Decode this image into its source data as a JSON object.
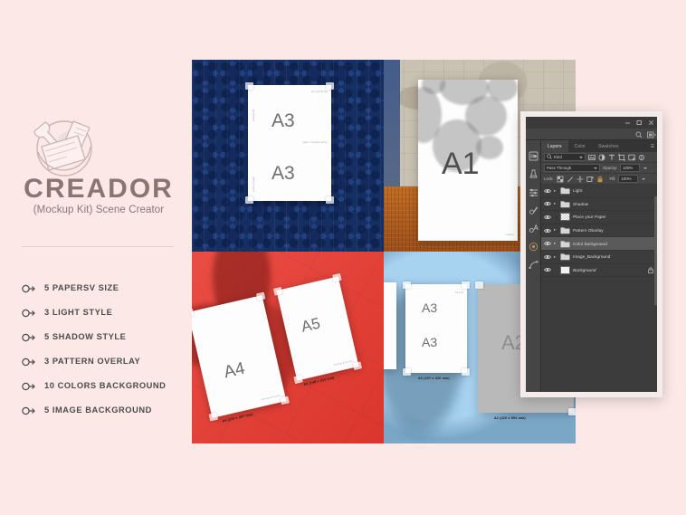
{
  "background_color": "#fce9e7",
  "brand": {
    "logo_icon": "toolbox-mockup-kit-logo",
    "title": "CREADOR",
    "subtitle": "(Mockup Kit) Scene Creator",
    "title_color": "#8a7573"
  },
  "features": {
    "bullet_icon": "arrow-in-circle-icon",
    "items": [
      {
        "label": "5 PAPERSV SIZE"
      },
      {
        "label": "3 LIGHT STYLE"
      },
      {
        "label": "5 SHADOW STYLE"
      },
      {
        "label": "3 PATTERN OVERLAY"
      },
      {
        "label": "10 COLORS BACKGROUND"
      },
      {
        "label": "5 IMAGE BACKGROUND"
      }
    ]
  },
  "collage": {
    "quadrants": [
      {
        "name": "navy-ornate-tile",
        "color": "#23417f"
      },
      {
        "name": "beige-stone-orange",
        "color": "#c9c2b3"
      },
      {
        "name": "red-flat",
        "color": "#e8392f"
      },
      {
        "name": "light-blue",
        "color": "#7ba7c7"
      }
    ],
    "papers": [
      {
        "id": "a3-navy",
        "size_top": "A3",
        "size_bottom": "A3",
        "micro_top_right": "size  A3 format",
        "micro_mid_right": "paper / mockup scene",
        "micro_left_1": "creador kit",
        "micro_left_2": "scene creator"
      },
      {
        "id": "a1-beige",
        "size_top": "A1",
        "micro_bottom_right": "creador"
      },
      {
        "id": "a4-red",
        "size_top": "A4",
        "dim_label": "A4 (210 x 297 mm)",
        "micro_bottom": "mockup kit scene"
      },
      {
        "id": "a5-red",
        "size_top": "A5",
        "dim_label": "A5 (148 x 210 mm)",
        "micro_bottom": "mockup kit scene"
      },
      {
        "id": "a3-blue",
        "size_top": "A3",
        "size_bottom": "A3",
        "dim_label": "A3 (297 x 420 mm)",
        "micro_right": "size a3"
      },
      {
        "id": "a2-blue",
        "size_top": "A2",
        "dim_label": "A2 (420 x 594 mm)"
      }
    ]
  },
  "photoshop": {
    "window_controls": [
      {
        "name": "minimize",
        "glyph": "—"
      },
      {
        "name": "maximize",
        "glyph": "❐"
      },
      {
        "name": "close",
        "glyph": "✕"
      }
    ],
    "searchbar": {
      "search_icon": "magnifier-icon",
      "arrange_icon": "arrange-documents-icon"
    },
    "dock_icons": [
      "history-brush-icon",
      "adjustments-icon",
      "properties-sliders-icon",
      "layer-styles-icon",
      "character-type-icon",
      "color-wheel-icon",
      "paths-icon"
    ],
    "tabs": [
      {
        "label": "Layers",
        "active": true
      },
      {
        "label": "Color",
        "active": false
      },
      {
        "label": "Swatches",
        "active": false
      }
    ],
    "filter": {
      "kind_label": "Kind",
      "search_icon": "magnifier-icon",
      "type_filters": [
        "filter-pixel-icon",
        "filter-adjustment-icon",
        "filter-type-icon",
        "filter-shape-icon",
        "filter-smartobject-icon"
      ],
      "toggle_icon": "filter-toggle-icon"
    },
    "blend": {
      "mode": "Pass Through",
      "opacity_label": "Opacity:",
      "opacity_value": "100%"
    },
    "lock": {
      "label": "Lock:",
      "icons": [
        "lock-transparent-pixels-icon",
        "lock-image-pixels-icon",
        "lock-position-icon",
        "lock-artboard-nesting-icon",
        "lock-all-icon"
      ],
      "fill_label": "Fill:",
      "fill_value": "100%"
    },
    "layers": [
      {
        "name": "Light",
        "thumb": "folder",
        "expandable": true,
        "visible": true,
        "selected": false,
        "locked": false,
        "italic": false
      },
      {
        "name": "Shadow",
        "thumb": "folder",
        "expandable": true,
        "visible": true,
        "selected": false,
        "locked": false,
        "italic": false
      },
      {
        "name": "Place your Paper",
        "thumb": "checker",
        "expandable": false,
        "visible": true,
        "selected": false,
        "locked": false,
        "italic": false
      },
      {
        "name": "Pattern Obarlay",
        "thumb": "folder",
        "expandable": true,
        "visible": true,
        "selected": false,
        "locked": false,
        "italic": false
      },
      {
        "name": "Color background",
        "thumb": "folder",
        "expandable": true,
        "visible": true,
        "selected": true,
        "locked": false,
        "italic": false
      },
      {
        "name": "Image_Background",
        "thumb": "folder",
        "expandable": true,
        "visible": true,
        "selected": false,
        "locked": false,
        "italic": false
      },
      {
        "name": "Background",
        "thumb": "white",
        "expandable": false,
        "visible": true,
        "selected": false,
        "locked": true,
        "italic": true
      }
    ]
  }
}
